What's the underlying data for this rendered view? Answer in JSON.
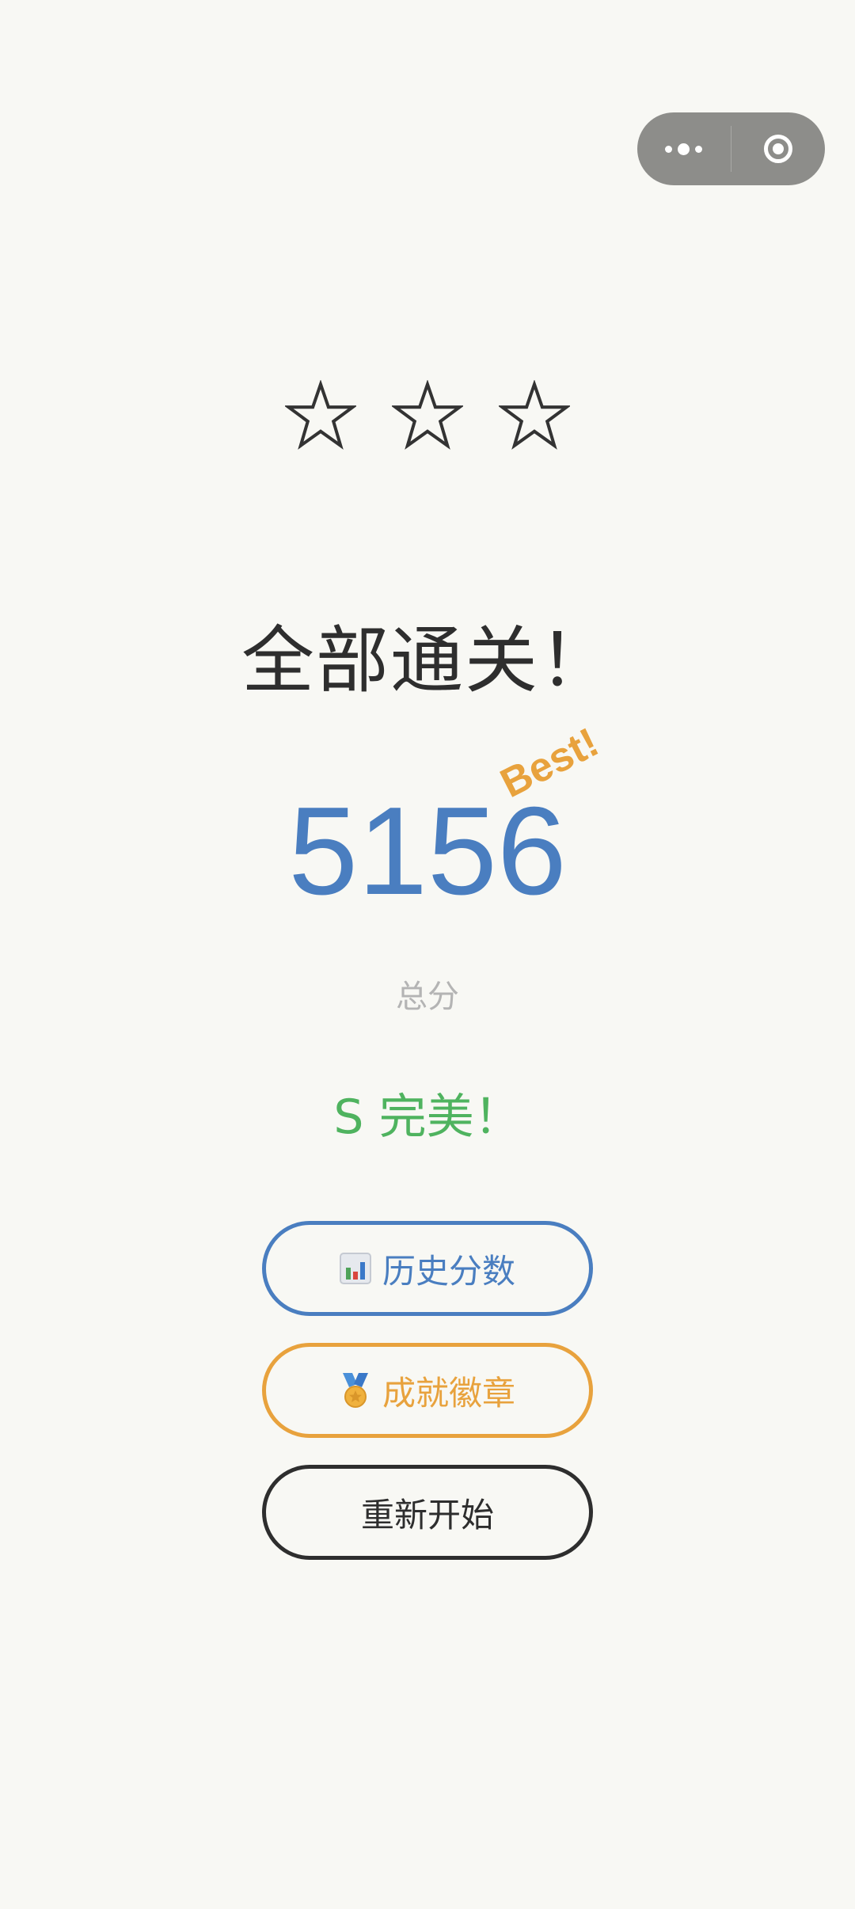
{
  "stars": {
    "total": 3,
    "filled": 0
  },
  "title": "全部通关！",
  "score": {
    "value": "5156",
    "best_tag": "Best!",
    "label": "总分"
  },
  "rating": "S 完美！",
  "buttons": {
    "history": {
      "label": "历史分数",
      "icon": "bar-chart-icon"
    },
    "badges": {
      "label": "成就徽章",
      "icon": "medal-icon"
    },
    "restart": {
      "label": "重新开始"
    }
  },
  "capsule": {
    "more_icon": "more-dots-icon",
    "close_icon": "target-circle-icon"
  },
  "colors": {
    "background": "#f8f8f4",
    "score": "#4a7ec0",
    "best": "#e8a23d",
    "rating": "#4fb35f",
    "history": "#4a7ec0",
    "badges": "#e8a23d",
    "restart": "#2e2e2e"
  }
}
